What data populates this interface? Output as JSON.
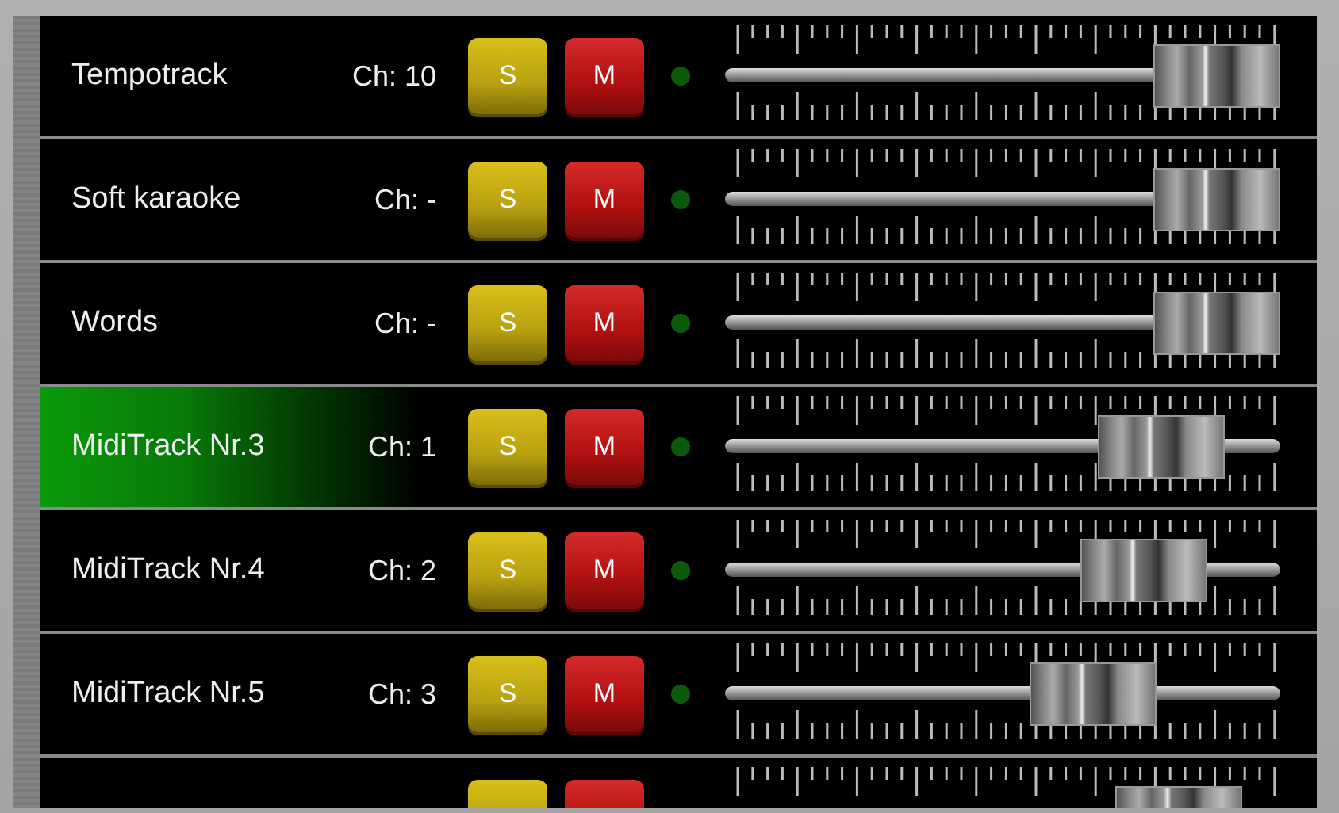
{
  "tracks": [
    {
      "name": "Tempotrack",
      "channel": "Ch: 10",
      "solo_label": "S",
      "mute_label": "M",
      "selected": false,
      "level": 1.0
    },
    {
      "name": "Soft karaoke",
      "channel": "Ch: -",
      "solo_label": "S",
      "mute_label": "M",
      "selected": false,
      "level": 1.0
    },
    {
      "name": "Words",
      "channel": "Ch: -",
      "solo_label": "S",
      "mute_label": "M",
      "selected": false,
      "level": 1.0
    },
    {
      "name": "MidiTrack Nr.3",
      "channel": "Ch: 1",
      "solo_label": "S",
      "mute_label": "M",
      "selected": true,
      "level": 0.87
    },
    {
      "name": "MidiTrack Nr.4",
      "channel": "Ch: 2",
      "solo_label": "S",
      "mute_label": "M",
      "selected": false,
      "level": 0.83
    },
    {
      "name": "MidiTrack Nr.5",
      "channel": "Ch: 3",
      "solo_label": "S",
      "mute_label": "M",
      "selected": false,
      "level": 0.71
    },
    {
      "selected": false,
      "level": 0.91
    }
  ]
}
